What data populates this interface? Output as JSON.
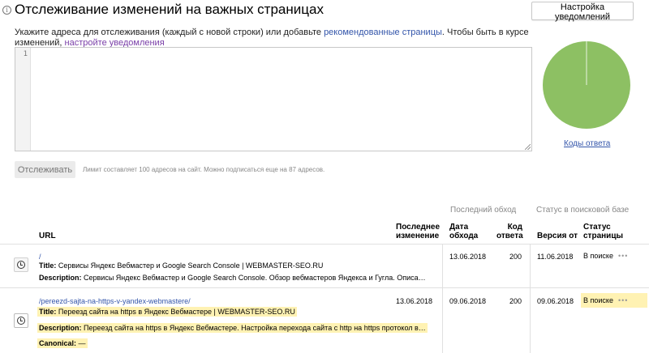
{
  "header": {
    "title": "Отслеживание изменений на важных страницах",
    "info_icon": "ⓘ",
    "settings_button": "Настройка уведомлений"
  },
  "instructions": {
    "text_before": "Укажите адреса для отслеживания (каждый с новой строки) или добавьте ",
    "recommended_link": "рекомендованные страницы",
    "text_middle": ". Чтобы быть в курсе изменений, ",
    "notify_link": "настройте уведомления"
  },
  "editor": {
    "line_number": "1",
    "value": ""
  },
  "actions": {
    "track_button": "Отслеживать",
    "limit_text": "Лимит составляет 100 адресов на сайт. Можно подписаться еще на 87 адресов."
  },
  "response_chart": {
    "link": "Коды ответа",
    "color": "#8dc063"
  },
  "chart_data": {
    "type": "pie",
    "values": [
      100
    ],
    "colors": [
      "#8dc063"
    ]
  },
  "table": {
    "group_headers": {
      "last_crawl": "Последний обход",
      "search_status": "Статус в поисковой базе"
    },
    "columns": {
      "url": "URL",
      "last_change_1": "Последнее",
      "last_change_2": "изменение",
      "crawl_date_1": "Дата",
      "crawl_date_2": "обхода",
      "code_1": "Код",
      "code_2": "ответа",
      "version": "Версия от",
      "page_status_1": "Статус",
      "page_status_2": "страницы"
    },
    "rows": [
      {
        "url": "/",
        "title_label": "Title:",
        "title": " Сервисы Яндекс Вебмастер и Google Search Console | WEBMASTER-SEO.RU",
        "desc_label": "Description:",
        "description": " Сервисы Яндекс Вебмастер и Google Search Console. Обзор вебмастеров Яндекса и Гугла. Описа…",
        "last_change": "",
        "crawl_date": "13.06.2018",
        "code": "200",
        "version": "11.06.2018",
        "status": "В поиске",
        "more": "•••"
      },
      {
        "url": "/pereezd-sajta-na-https-v-yandex-webmastere/",
        "title_label": "Title:",
        "title": " Переезд сайта на https в Яндекс Вебмастере | WEBMASTER-SEO.RU",
        "desc_label": "Description:",
        "description": " Переезд сайта на https в Яндекс Вебмастере. Настройка перехода сайта с http на https протокол в…",
        "canonical_label": "Canonical:",
        "canonical": " —",
        "last_change": "13.06.2018",
        "crawl_date": "09.06.2018",
        "code": "200",
        "version": "09.06.2018",
        "status": "В поиске",
        "more": "•••"
      }
    ]
  }
}
